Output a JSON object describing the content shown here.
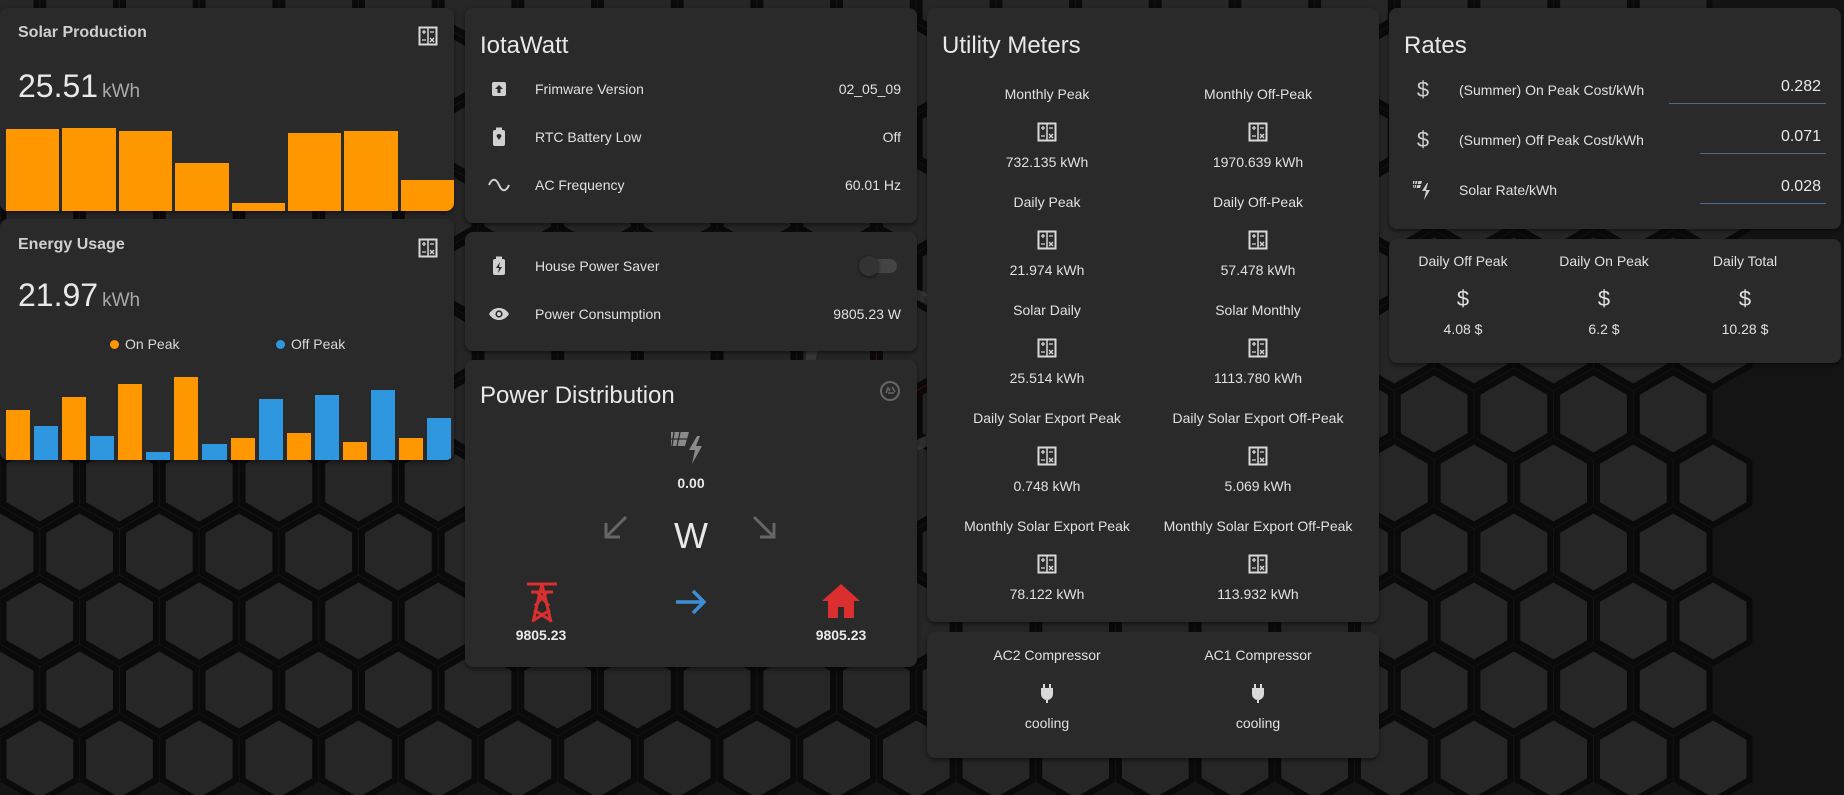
{
  "solar": {
    "title": "Solar Production",
    "value": "25.51",
    "unit": "kWh",
    "bars": [
      0.97,
      0.98,
      0.94,
      0.56,
      0.1,
      0.92,
      0.94,
      0.37
    ]
  },
  "energy": {
    "title": "Energy Usage",
    "value": "21.97",
    "unit": "kWh",
    "legend_on": "On Peak",
    "legend_off": "Off Peak",
    "bars": [
      {
        "s": "on",
        "v": 0.6
      },
      {
        "s": "off",
        "v": 0.41
      },
      {
        "s": "on",
        "v": 0.76
      },
      {
        "s": "off",
        "v": 0.29
      },
      {
        "s": "on",
        "v": 0.92
      },
      {
        "s": "off",
        "v": 0.1
      },
      {
        "s": "on",
        "v": 1.0
      },
      {
        "s": "off",
        "v": 0.19
      },
      {
        "s": "on",
        "v": 0.26
      },
      {
        "s": "off",
        "v": 0.73
      },
      {
        "s": "on",
        "v": 0.32
      },
      {
        "s": "off",
        "v": 0.78
      },
      {
        "s": "on",
        "v": 0.22
      },
      {
        "s": "off",
        "v": 0.84
      },
      {
        "s": "on",
        "v": 0.26
      },
      {
        "s": "off",
        "v": 0.51
      }
    ]
  },
  "iotawatt": {
    "title": "IotaWatt",
    "rows": [
      {
        "icon": "firmware-icon",
        "label": "Frimware Version",
        "value": "02_05_09"
      },
      {
        "icon": "battery-alert-icon",
        "label": "RTC Battery Low",
        "value": "Off"
      },
      {
        "icon": "sine-wave-icon",
        "label": "AC Frequency",
        "value": "60.01 Hz"
      }
    ]
  },
  "house": {
    "rows": [
      {
        "icon": "battery-charging-icon",
        "label": "House Power Saver"
      },
      {
        "icon": "eye-icon",
        "label": "Power Consumption",
        "value": "9805.23 W"
      }
    ],
    "toggle_on": false
  },
  "distribution": {
    "title": "Power Distribution",
    "solar_value": "0.00",
    "unit": "W",
    "grid_value": "9805.23",
    "home_value": "9805.23",
    "colors": {
      "grid": "#db2f2f",
      "home": "#db2f2f",
      "flow": "#3c8fd6"
    }
  },
  "utility": {
    "title": "Utility Meters",
    "cells": [
      {
        "name": "Monthly Peak",
        "value": "732.135 kWh"
      },
      {
        "name": "Monthly Off-Peak",
        "value": "1970.639 kWh"
      },
      {
        "name": "Daily Peak",
        "value": "21.974 kWh"
      },
      {
        "name": "Daily Off-Peak",
        "value": "57.478 kWh"
      },
      {
        "name": "Solar Daily",
        "value": "25.514 kWh"
      },
      {
        "name": "Solar Monthly",
        "value": "1113.780 kWh"
      },
      {
        "name": "Daily Solar Export Peak",
        "value": "0.748 kWh"
      },
      {
        "name": "Daily Solar Export Off-Peak",
        "value": "5.069 kWh"
      },
      {
        "name": "Monthly Solar Export Peak",
        "value": "78.122 kWh"
      },
      {
        "name": "Monthly Solar Export Off-Peak",
        "value": "113.932 kWh"
      }
    ]
  },
  "compressors": [
    {
      "name": "AC2 Compressor",
      "state": "cooling"
    },
    {
      "name": "AC1 Compressor",
      "state": "cooling"
    }
  ],
  "rates": {
    "title": "Rates",
    "rows": [
      {
        "icon": "dollar-icon",
        "label": "(Summer) On Peak Cost/kWh",
        "value": "0.282"
      },
      {
        "icon": "dollar-icon",
        "label": "(Summer) Off Peak Cost/kWh",
        "value": "0.071"
      },
      {
        "icon": "solar-power-icon",
        "label": "Solar Rate/kWh",
        "value": "0.028"
      }
    ]
  },
  "costs": [
    {
      "name": "Daily Off Peak",
      "value": "4.08 $"
    },
    {
      "name": "Daily On Peak",
      "value": "6.2 $"
    },
    {
      "name": "Daily Total",
      "value": "10.28 $"
    }
  ]
}
